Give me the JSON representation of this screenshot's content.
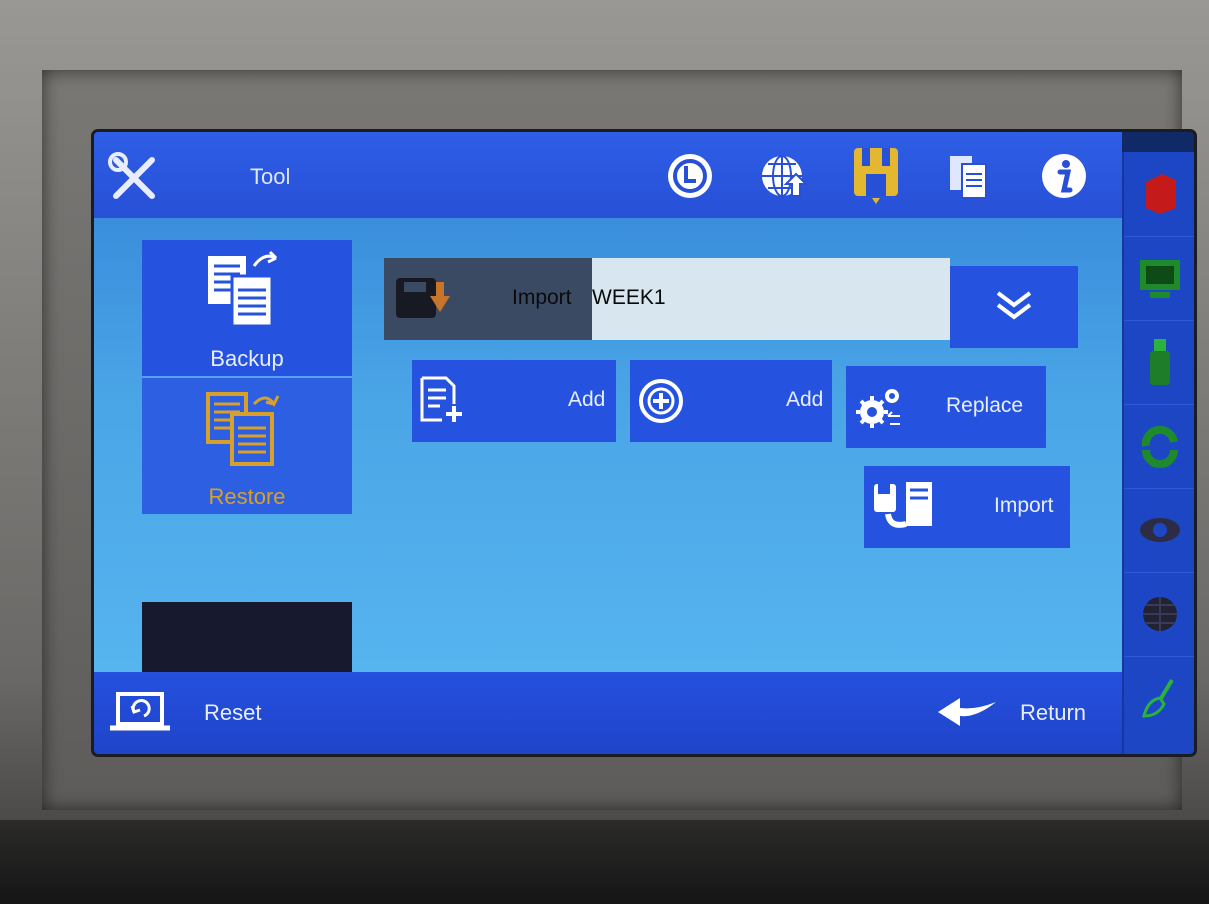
{
  "header": {
    "title": "Tool"
  },
  "top_icons": [
    "clock-icon",
    "globe-icon",
    "disk-icon",
    "documents-icon",
    "info-icon"
  ],
  "sidebar": {
    "items": [
      {
        "label": "Backup",
        "icon": "backup-documents-icon"
      },
      {
        "label": "Restore",
        "icon": "restore-documents-icon"
      }
    ]
  },
  "import_field": {
    "label": "Import",
    "value": "WEEK1"
  },
  "actions": {
    "add_file": "Add",
    "add_target": "Add",
    "replace": "Replace",
    "import": "Import"
  },
  "footer": {
    "reset": "Reset",
    "return": "Return"
  },
  "colors": {
    "bar": "#2553e0",
    "main": "#4aa5e6",
    "restore_active": "#d7a02a"
  }
}
